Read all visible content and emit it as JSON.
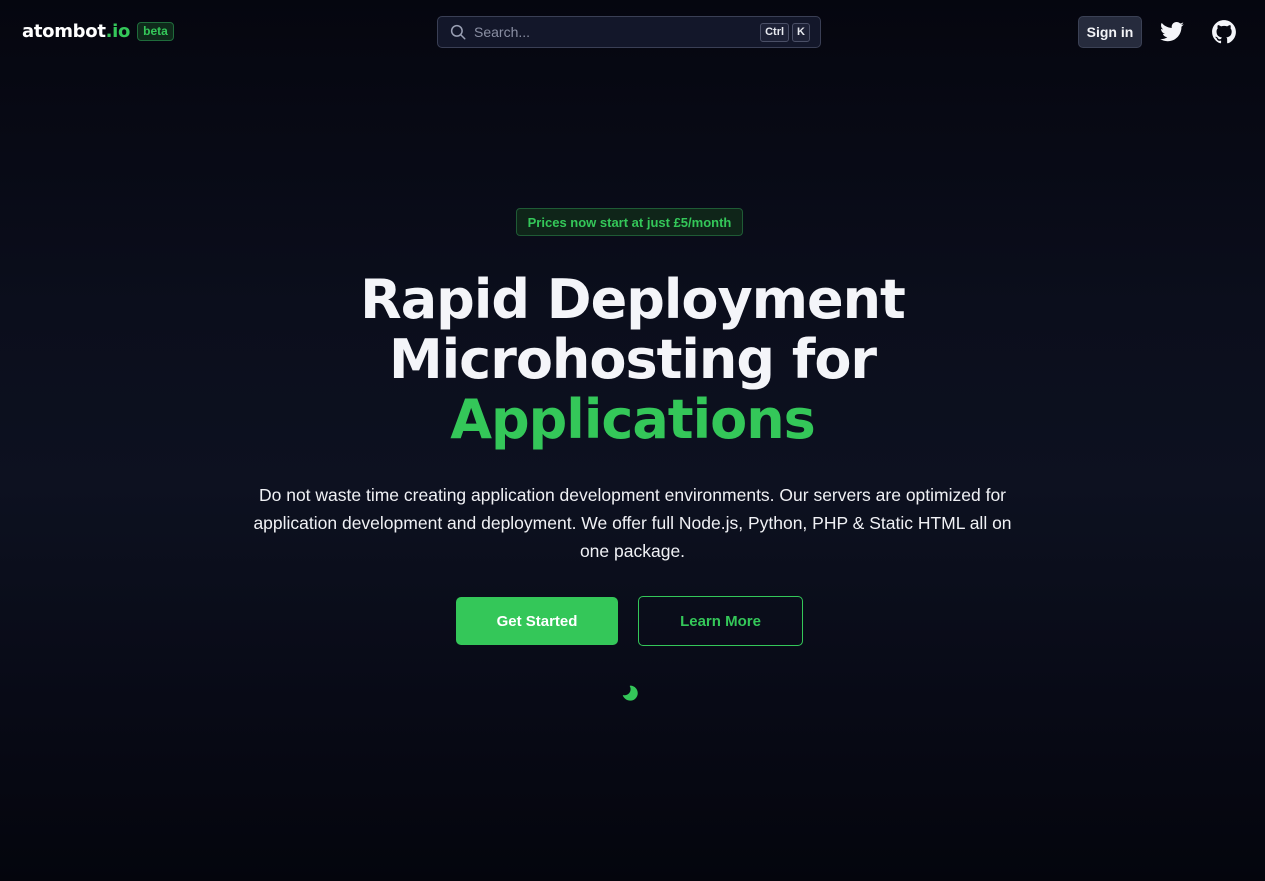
{
  "header": {
    "brand_name": "atombot",
    "brand_tld": ".io",
    "beta_label": "beta",
    "search": {
      "placeholder": "Search...",
      "shortcut_keys": [
        "Ctrl",
        "K"
      ]
    },
    "signin_label": "Sign in",
    "icons": {
      "search": "search-icon",
      "twitter": "twitter-icon",
      "github": "github-icon"
    }
  },
  "hero": {
    "badge": "Prices now start at just £5/month",
    "headline_line1": "Rapid Deployment",
    "headline_line2": "Microhosting for",
    "headline_accent": "Applications",
    "subtitle": "Do not waste time creating application development environments. Our servers are optimized for application development and deployment. We offer full Node.js, Python, PHP & Static HTML all on one package.",
    "primary_button": "Get Started",
    "secondary_button": "Learn More",
    "theme_icon": "moon-icon"
  },
  "colors": {
    "accent": "#34c759",
    "background": "#0b0e1c",
    "text": "#f4f5f9"
  }
}
